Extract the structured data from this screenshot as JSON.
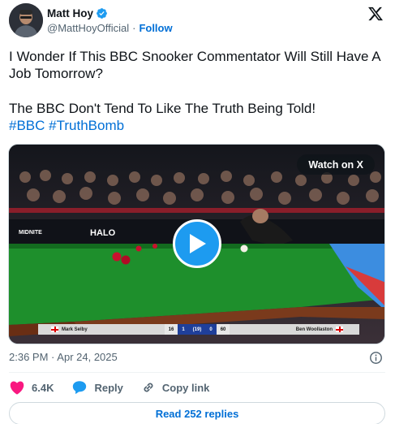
{
  "author": {
    "name": "Matt Hoy",
    "handle": "@MattHoyOfficial",
    "separator": "·",
    "follow_label": "Follow",
    "verified": true,
    "avatar_icon": "profile-photo"
  },
  "platform": {
    "logo_icon": "x-logo"
  },
  "tweet": {
    "line1": "I Wonder If This BBC Snooker Commentator Will Still Have A Job Tomorrow?",
    "line2": "The BBC Don't Tend To Like The Truth Being Told!",
    "hashtags": [
      "#BBC",
      "#TruthBomb"
    ]
  },
  "media": {
    "watch_label": "Watch on X",
    "play_icon": "play-icon",
    "scoreboard": {
      "player1": "Mark Selby",
      "score1": "16",
      "frames1": "1",
      "frames_total": "(19)",
      "frames2": "0",
      "score2": "60",
      "player2": "Ben Woollaston"
    },
    "arena_signs": [
      "MIDNITE",
      "HALO"
    ]
  },
  "meta": {
    "time": "2:36 PM",
    "separator": "·",
    "date": "Apr 24, 2025",
    "info_icon": "info-icon"
  },
  "actions": {
    "like_count": "6.4K",
    "reply_label": "Reply",
    "copy_label": "Copy link"
  },
  "read_replies_label": "Read 252 replies",
  "colors": {
    "link": "#006fd6",
    "like": "#f91880",
    "reply": "#1d9bf0",
    "secondary_text": "#536471",
    "verified": "#1d9bf0"
  }
}
